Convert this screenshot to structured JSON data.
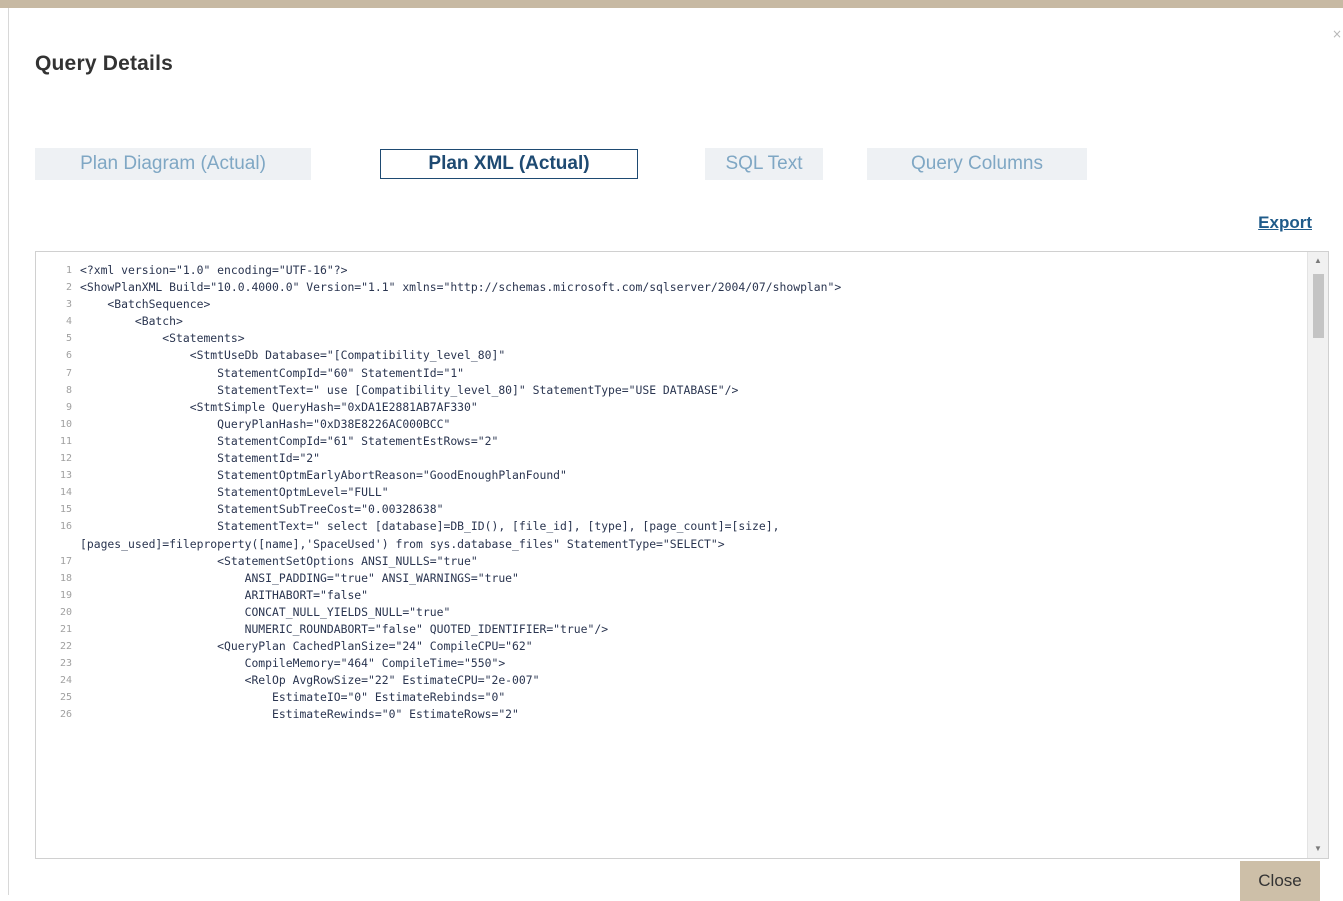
{
  "dialog": {
    "title": "Query Details",
    "close_icon": "×",
    "export_label": "Export",
    "close_button_label": "Close"
  },
  "tabs": [
    {
      "label": "Plan Diagram (Actual)",
      "active": false
    },
    {
      "label": "Plan XML (Actual)",
      "active": true
    },
    {
      "label": "SQL Text",
      "active": false
    },
    {
      "label": "Query Columns",
      "active": false
    }
  ],
  "editor": {
    "lines": [
      {
        "n": "1",
        "text": "<?xml version=\"1.0\" encoding=\"UTF-16\"?>"
      },
      {
        "n": "2",
        "text": "<ShowPlanXML Build=\"10.0.4000.0\" Version=\"1.1\" xmlns=\"http://schemas.microsoft.com/sqlserver/2004/07/showplan\">"
      },
      {
        "n": "3",
        "text": "    <BatchSequence>"
      },
      {
        "n": "4",
        "text": "        <Batch>"
      },
      {
        "n": "5",
        "text": "            <Statements>"
      },
      {
        "n": "6",
        "text": "                <StmtUseDb Database=\"[Compatibility_level_80]\""
      },
      {
        "n": "7",
        "text": "                    StatementCompId=\"60\" StatementId=\"1\""
      },
      {
        "n": "8",
        "text": "                    StatementText=\" use [Compatibility_level_80]\" StatementType=\"USE DATABASE\"/>"
      },
      {
        "n": "9",
        "text": "                <StmtSimple QueryHash=\"0xDA1E2881AB7AF330\""
      },
      {
        "n": "10",
        "text": "                    QueryPlanHash=\"0xD38E8226AC000BCC\""
      },
      {
        "n": "11",
        "text": "                    StatementCompId=\"61\" StatementEstRows=\"2\""
      },
      {
        "n": "12",
        "text": "                    StatementId=\"2\""
      },
      {
        "n": "13",
        "text": "                    StatementOptmEarlyAbortReason=\"GoodEnoughPlanFound\""
      },
      {
        "n": "14",
        "text": "                    StatementOptmLevel=\"FULL\""
      },
      {
        "n": "15",
        "text": "                    StatementSubTreeCost=\"0.00328638\""
      },
      {
        "n": "16",
        "text": "                    StatementText=\" select [database]=DB_ID(), [file_id], [type], [page_count]=[size],\n[pages_used]=fileproperty([name],'SpaceUsed') from sys.database_files\" StatementType=\"SELECT\">",
        "wrap": true
      },
      {
        "n": "17",
        "text": "                    <StatementSetOptions ANSI_NULLS=\"true\""
      },
      {
        "n": "18",
        "text": "                        ANSI_PADDING=\"true\" ANSI_WARNINGS=\"true\""
      },
      {
        "n": "19",
        "text": "                        ARITHABORT=\"false\""
      },
      {
        "n": "20",
        "text": "                        CONCAT_NULL_YIELDS_NULL=\"true\""
      },
      {
        "n": "21",
        "text": "                        NUMERIC_ROUNDABORT=\"false\" QUOTED_IDENTIFIER=\"true\"/>"
      },
      {
        "n": "22",
        "text": "                    <QueryPlan CachedPlanSize=\"24\" CompileCPU=\"62\""
      },
      {
        "n": "23",
        "text": "                        CompileMemory=\"464\" CompileTime=\"550\">"
      },
      {
        "n": "24",
        "text": "                        <RelOp AvgRowSize=\"22\" EstimateCPU=\"2e-007\""
      },
      {
        "n": "25",
        "text": "                            EstimateIO=\"0\" EstimateRebinds=\"0\""
      },
      {
        "n": "26",
        "text": "                            EstimateRewinds=\"0\" EstimateRows=\"2\""
      }
    ]
  },
  "colors": {
    "accent": "#1e4a72",
    "inactive_tab_text": "#7fa7c4",
    "close_button_bg": "#cdbfa8"
  }
}
